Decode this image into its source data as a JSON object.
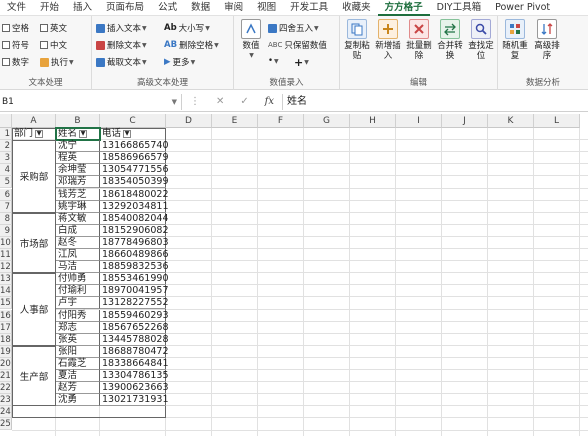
{
  "tabs": [
    "文件",
    "开始",
    "插入",
    "页面布局",
    "公式",
    "数据",
    "审阅",
    "视图",
    "开发工具",
    "收藏夹",
    "方方格子",
    "DIY工具箱",
    "Power Pivot"
  ],
  "active_tab": "方方格子",
  "ribbon": {
    "text_group": {
      "label": "文本处理",
      "checks": [
        "空格",
        "英文",
        "符号",
        "中文",
        "数字"
      ],
      "exec": "执行"
    },
    "adv_text_group": {
      "label": "高级文本处理",
      "items": [
        "插入文本",
        "删除文本",
        "截取文本",
        "大小写",
        "删除空格",
        "更多"
      ]
    },
    "num_group": {
      "label": "数值录入",
      "big": "数值",
      "items": [
        "四舍五入",
        "只保留数值"
      ],
      "plus": "+",
      "dot": "•"
    },
    "edit_group": {
      "label": "编辑",
      "buttons": [
        "复制粘贴",
        "新增插入",
        "批量删除",
        "合并转换",
        "查找定位"
      ]
    },
    "analysis_group": {
      "label": "数据分析",
      "buttons": [
        "随机重复",
        "高级排序"
      ]
    }
  },
  "formula_bar": {
    "name_box": "B1",
    "value": "姓名",
    "fx": "fx",
    "cancel": "✕",
    "confirm": "✓"
  },
  "columns": [
    "A",
    "B",
    "C",
    "D",
    "E",
    "F",
    "G",
    "H",
    "I",
    "J",
    "K",
    "L"
  ],
  "rows": [
    "1",
    "2",
    "3",
    "4",
    "5",
    "6",
    "7",
    "8",
    "9",
    "10",
    "11",
    "12",
    "13",
    "14",
    "15",
    "16",
    "17",
    "18",
    "19",
    "20",
    "21",
    "22",
    "23",
    "24",
    "25"
  ],
  "headers": {
    "dept": "部门",
    "name": "姓名",
    "phone": "电话"
  },
  "departments": [
    {
      "name": "采购部",
      "start": 2,
      "span": 6
    },
    {
      "name": "市场部",
      "start": 8,
      "span": 5
    },
    {
      "name": "人事部",
      "start": 13,
      "span": 6
    },
    {
      "name": "生产部",
      "start": 19,
      "span": 5
    }
  ],
  "records": [
    {
      "name": "沈宁",
      "phone": "13166865740"
    },
    {
      "name": "程英",
      "phone": "18586966579"
    },
    {
      "name": "余坤莹",
      "phone": "13054771556"
    },
    {
      "name": "邓瑞芳",
      "phone": "18354050399"
    },
    {
      "name": "钱芳芝",
      "phone": "18618480022"
    },
    {
      "name": "姚宇琳",
      "phone": "13292034811"
    },
    {
      "name": "蒋文敏",
      "phone": "18540082044"
    },
    {
      "name": "白成",
      "phone": "18152906082"
    },
    {
      "name": "赵冬",
      "phone": "18778496803"
    },
    {
      "name": "江凤",
      "phone": "18660489866"
    },
    {
      "name": "马洁",
      "phone": "18859832536"
    },
    {
      "name": "付帅勇",
      "phone": "18553461990"
    },
    {
      "name": "付瑜利",
      "phone": "18970041957"
    },
    {
      "name": "卢宇",
      "phone": "13128227552"
    },
    {
      "name": "付阳秀",
      "phone": "18559460293"
    },
    {
      "name": "郑志",
      "phone": "18567652268"
    },
    {
      "name": "张英",
      "phone": "13445788028"
    },
    {
      "name": "张阳",
      "phone": "18688780472"
    },
    {
      "name": "石霞芝",
      "phone": "18338664841"
    },
    {
      "name": "夏洁",
      "phone": "13304786135"
    },
    {
      "name": "赵芳",
      "phone": "13900623663"
    },
    {
      "name": "沈勇",
      "phone": "13021731931"
    }
  ]
}
